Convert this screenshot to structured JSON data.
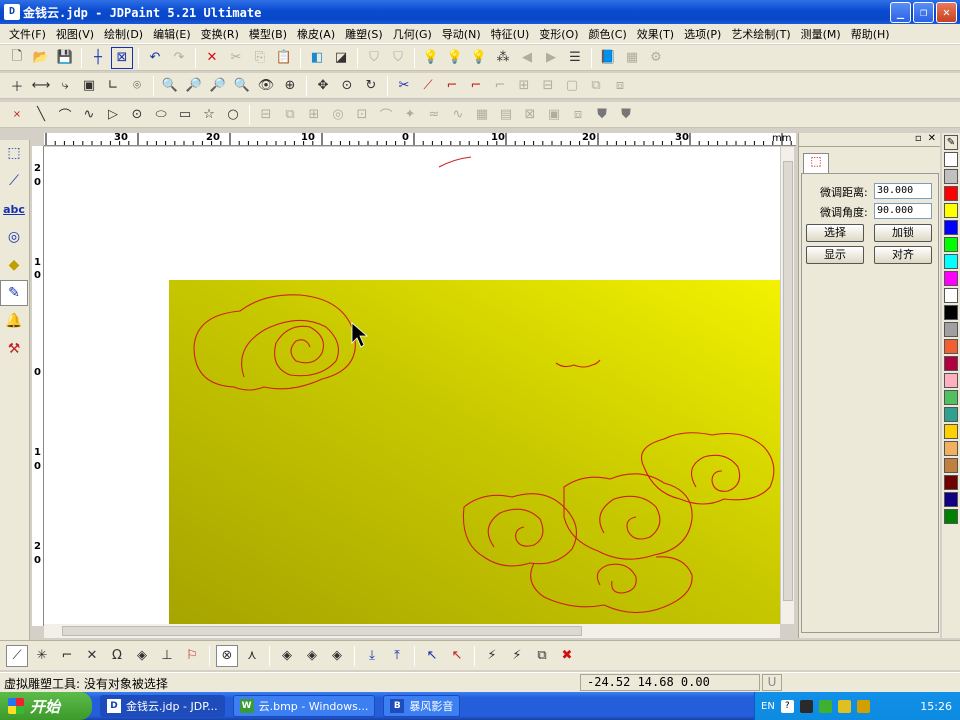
{
  "window": {
    "title": "金钱云.jdp - JDPaint 5.21 Ultimate",
    "app_icon": "D"
  },
  "menu": [
    "文件(F)",
    "视图(V)",
    "绘制(D)",
    "编辑(E)",
    "变换(R)",
    "模型(B)",
    "橡皮(A)",
    "雕塑(S)",
    "几何(G)",
    "导动(N)",
    "特征(U)",
    "变形(O)",
    "颜色(C)",
    "效果(T)",
    "选项(P)",
    "艺术绘制(T)",
    "测量(M)",
    "帮助(H)"
  ],
  "ruler": {
    "top_labels": [
      "30",
      "20",
      "10",
      "0",
      "10",
      "20",
      "30"
    ],
    "unit": "mm",
    "left_labels": [
      "2",
      "0",
      "1",
      "0",
      "0",
      "1",
      "0",
      "2",
      "0"
    ]
  },
  "panel": {
    "fine_distance_label": "微调距离:",
    "fine_distance_value": "30.000",
    "fine_angle_label": "微调角度:",
    "fine_angle_value": "90.000",
    "select_button": "选择",
    "lock_button": "加锁",
    "show_button": "显示",
    "align_button": "对齐"
  },
  "palette": [
    "#ffffff",
    "#c0c0c0",
    "#ff0000",
    "#ffff00",
    "#0000ff",
    "#00ff00",
    "#00ffff",
    "#ff00ff",
    "#ffffff",
    "#000000",
    "#a0a0a0",
    "#f06030",
    "#b00040",
    "#ffb0c0",
    "#50c060",
    "#30a090",
    "#ffd000",
    "#f0b060",
    "#c08040",
    "#700000",
    "#100080",
    "#008000"
  ],
  "status": {
    "message": "虚拟雕塑工具: 没有对象被选择",
    "coordinates": "-24.52 14.68 0.00",
    "unit_flag": "U"
  },
  "taskbar": {
    "start_label": "开始",
    "tasks": [
      {
        "label": "金钱云.jdp - JDP...",
        "icon": "D"
      },
      {
        "label": "云.bmp - Windows...",
        "icon": "W"
      },
      {
        "label": "暴风影音",
        "icon": "B"
      }
    ],
    "tray_lang": "EN",
    "clock": "15:26"
  },
  "colors": {
    "canvas_fill": "#c8c800",
    "curve": "#cc2020",
    "title_blue": "#0a4bd0"
  }
}
